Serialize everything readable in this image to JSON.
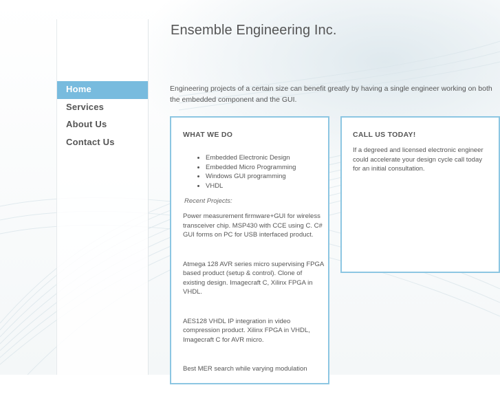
{
  "header": {
    "title": "Ensemble Engineering Inc."
  },
  "nav": {
    "items": [
      {
        "label": "Home",
        "active": true
      },
      {
        "label": "Services",
        "active": false
      },
      {
        "label": "About Us",
        "active": false
      },
      {
        "label": "Contact Us",
        "active": false
      }
    ]
  },
  "intro": "Engineering projects of a certain size can benefit greatly by having a single engineer working on both the embedded component and the GUI.",
  "what_we_do": {
    "heading": "WHAT WE DO",
    "services": [
      "Embedded Electronic Design",
      "Embedded Micro Programming",
      "Windows GUI programming",
      "VHDL"
    ],
    "recent_label": "Recent Projects:",
    "projects": [
      "Power measurement firmware+GUI  for wireless transceiver chip.  MSP430 with CCE using C. C# GUI forms on PC for USB interfaced product.",
      "Atmega 128 AVR series micro supervising FPGA based product (setup & control).  Clone of existing design.  Imagecraft C, Xilinx FPGA in VHDL.",
      "AES128 VHDL IP integration in video compression product.  Xilinx FPGA in VHDL, Imagecraft C for AVR micro.",
      "Best MER search while varying modulation"
    ]
  },
  "call_us": {
    "heading": "CALL US TODAY!",
    "text": "If a degreed and licensed electronic engineer could accelerate your  design cycle call today for an initial consultation."
  },
  "colors": {
    "accent": "#78bbde",
    "box_border": "#8cc6e2",
    "text": "#555555"
  }
}
